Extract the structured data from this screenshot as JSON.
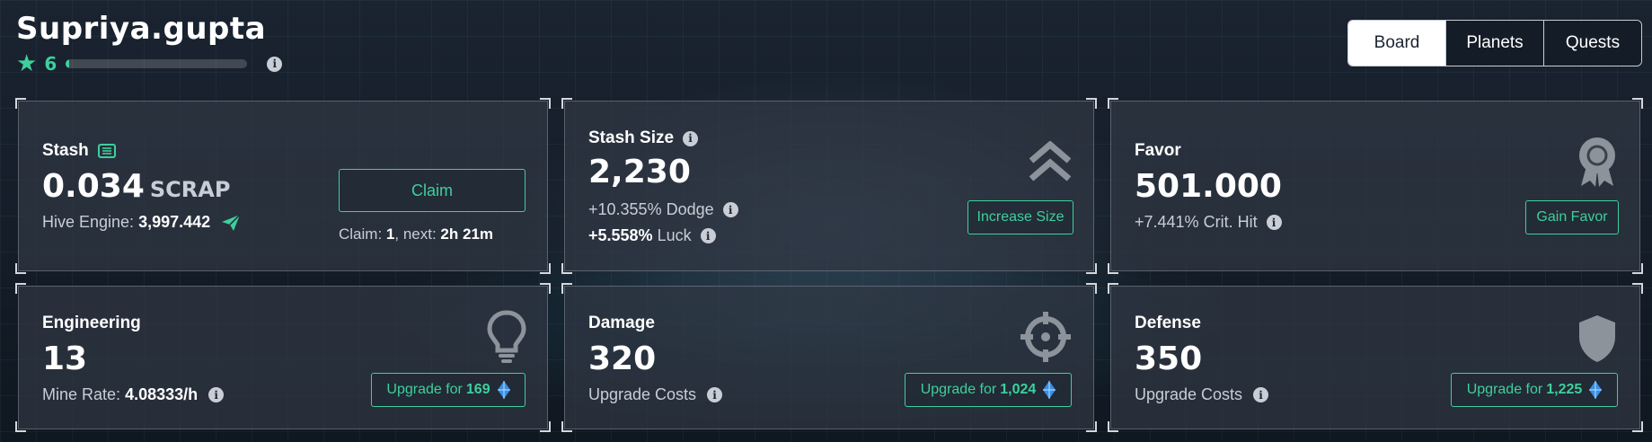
{
  "profile": {
    "username": "Supriya.gupta",
    "level": "6",
    "xp_progress": 0.02,
    "info_icon": "info-icon"
  },
  "tabs": [
    {
      "label": "Board",
      "active": true
    },
    {
      "label": "Planets",
      "active": false
    },
    {
      "label": "Quests",
      "active": false
    }
  ],
  "stash": {
    "label": "Stash",
    "amount": "0.034",
    "unit": "SCRAP",
    "hive_label": "Hive Engine:",
    "hive_value": "3,997.442",
    "claim_button": "Claim",
    "claim_label": "Claim:",
    "claim_count": "1",
    "next_label": ", next:",
    "next_value": "2h 21m"
  },
  "stash_size": {
    "label": "Stash Size",
    "value": "2,230",
    "dodge_value": "+10.355%",
    "dodge_label": "Dodge",
    "luck_value": "+5.558%",
    "luck_label": "Luck",
    "button": "Increase Size"
  },
  "favor": {
    "label": "Favor",
    "value": "501.000",
    "crit_value": "+7.441%",
    "crit_label": "Crit. Hit",
    "button": "Gain Favor"
  },
  "engineering": {
    "label": "Engineering",
    "value": "13",
    "rate_label": "Mine Rate:",
    "rate_value": "4.08333/h",
    "button_label": "Upgrade for",
    "button_cost": "169"
  },
  "damage": {
    "label": "Damage",
    "value": "320",
    "costs_label": "Upgrade Costs",
    "button_label": "Upgrade for",
    "button_cost": "1,024"
  },
  "defense": {
    "label": "Defense",
    "value": "350",
    "costs_label": "Upgrade Costs",
    "button_label": "Upgrade for",
    "button_cost": "1,225"
  },
  "colors": {
    "accent": "#3fcf9c",
    "crystal": "#3a8fe8",
    "text_muted": "#c9ced6"
  }
}
